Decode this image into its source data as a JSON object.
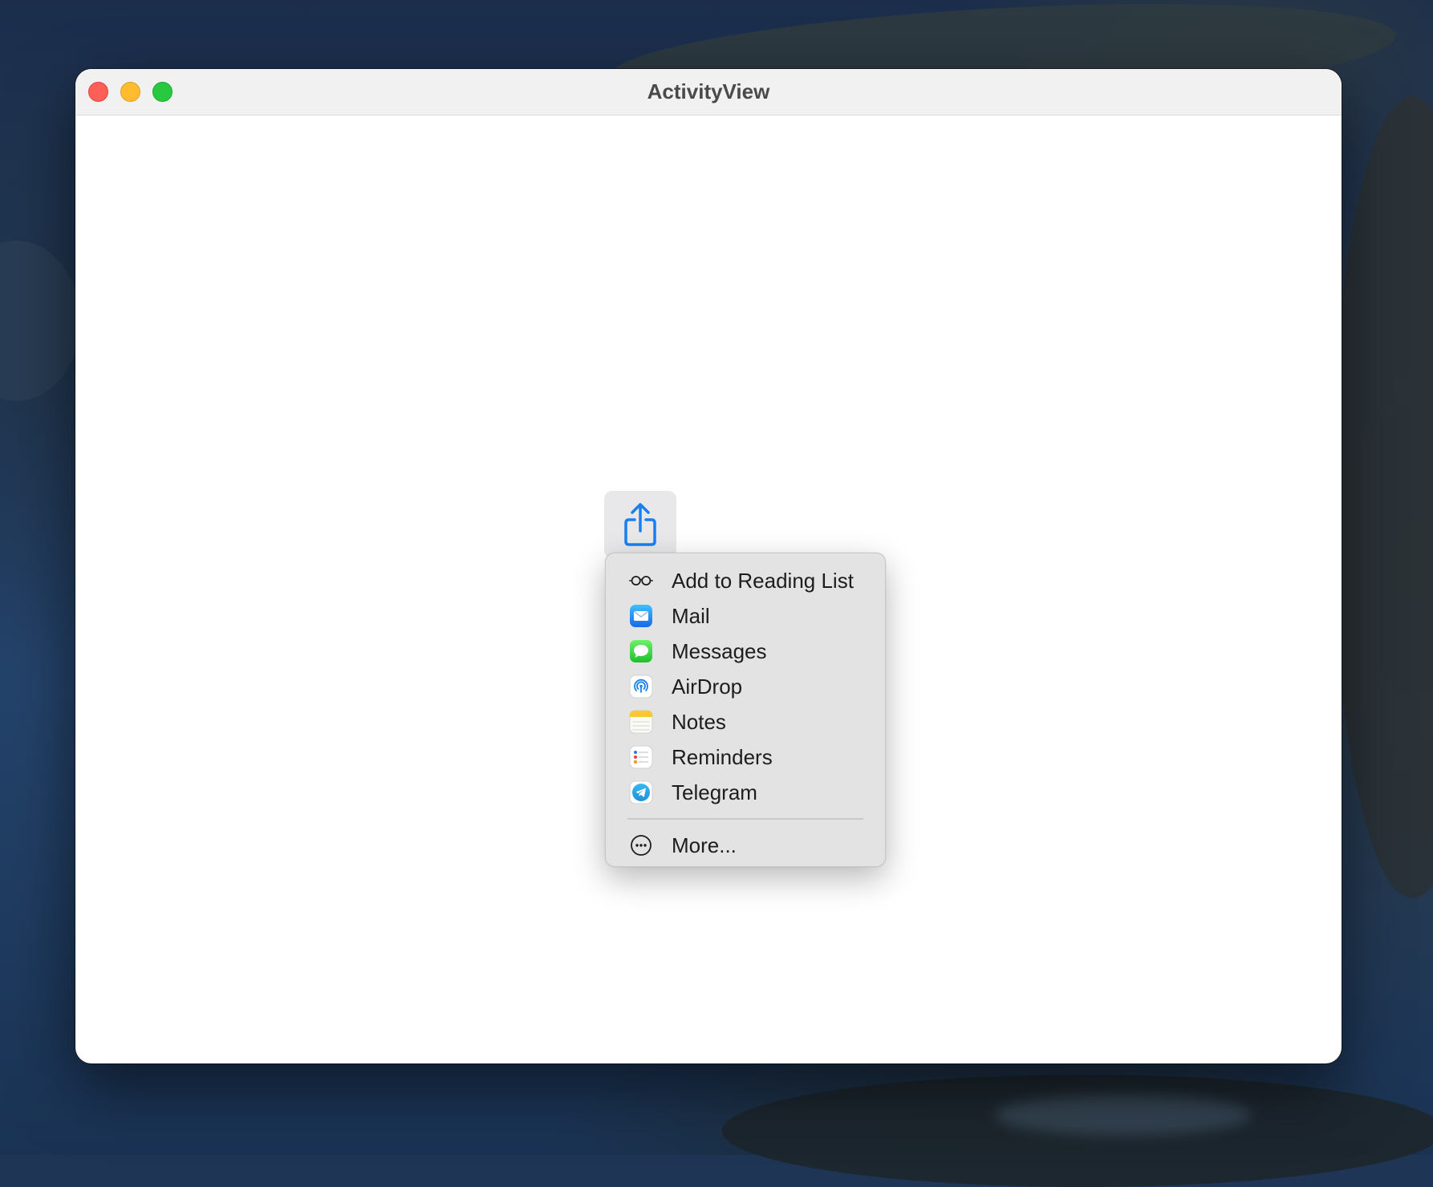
{
  "window": {
    "title": "ActivityView"
  },
  "share_button": {
    "icon": "share-icon"
  },
  "menu": {
    "items": [
      {
        "label": "Add to Reading List",
        "icon": "reading-glasses-icon"
      },
      {
        "label": "Mail",
        "icon": "mail-app-icon"
      },
      {
        "label": "Messages",
        "icon": "messages-app-icon"
      },
      {
        "label": "AirDrop",
        "icon": "airdrop-icon"
      },
      {
        "label": "Notes",
        "icon": "notes-app-icon"
      },
      {
        "label": "Reminders",
        "icon": "reminders-app-icon"
      },
      {
        "label": "Telegram",
        "icon": "telegram-app-icon"
      }
    ],
    "more": {
      "label": "More...",
      "icon": "more-ellipsis-icon"
    }
  },
  "colors": {
    "accent": "#1a7ff0",
    "close": "#fe5f57",
    "minimize": "#febc2e",
    "zoom": "#28c840"
  }
}
